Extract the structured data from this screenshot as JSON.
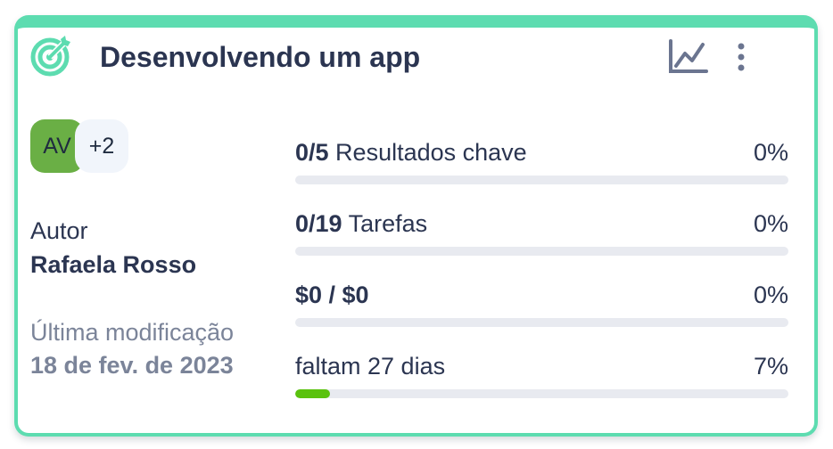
{
  "card": {
    "accent_color": "#5ddcb0",
    "title": "Desenvolvendo um app",
    "icons": {
      "goal": "target-arrow-icon",
      "chart": "line-chart-icon",
      "menu": "vertical-dots-icon"
    },
    "avatars": {
      "initials": "AV",
      "extra_count": "+2",
      "color": "#6aaf45"
    },
    "author": {
      "label": "Autor",
      "name": "Rafaela Rosso"
    },
    "modified": {
      "label": "Última modificação",
      "date": "18 de fev. de 2023"
    },
    "metrics": [
      {
        "bold": "0/5",
        "text": " Resultados chave",
        "percent_label": "0%",
        "progress": 0
      },
      {
        "bold": "0/19",
        "text": " Tarefas",
        "percent_label": "0%",
        "progress": 0
      },
      {
        "bold": "$0 / $0",
        "text": "",
        "percent_label": "0%",
        "progress": 0
      },
      {
        "bold": "",
        "text": "faltam 27 dias",
        "percent_label": "7%",
        "progress": 7
      }
    ],
    "progress_color": "#5ac20e"
  }
}
